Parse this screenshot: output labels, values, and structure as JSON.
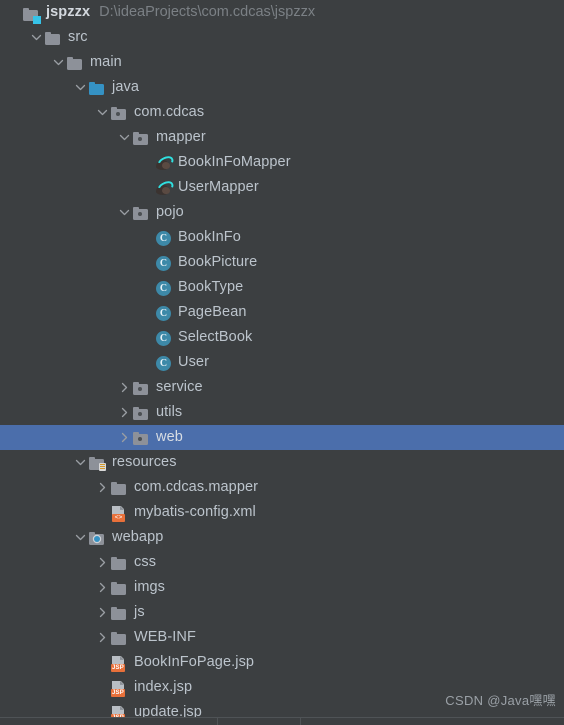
{
  "window": {
    "background_color": "#3c3f41",
    "selection_color": "#4b6eab",
    "text_color": "#bcc4cc",
    "path_text_color": "#7b8085"
  },
  "project": {
    "root_label": "jspzzx",
    "root_path": "D:\\ideaProjects\\com.cdcas\\jspzzx"
  },
  "watermark": "CSDN @Java嘿嘿",
  "tree": {
    "items": [
      {
        "label": "jspzzx",
        "path": "D:\\ideaProjects\\com.cdcas\\jspzzx",
        "depth": 0,
        "icon": "project-root-folder-icon",
        "arrow": "none",
        "selected": false
      },
      {
        "label": "src",
        "depth": 1,
        "icon": "folder-icon",
        "arrow": "expanded",
        "selected": false
      },
      {
        "label": "main",
        "depth": 2,
        "icon": "folder-icon",
        "arrow": "expanded",
        "selected": false
      },
      {
        "label": "java",
        "depth": 3,
        "icon": "source-root-folder-icon",
        "arrow": "expanded",
        "selected": false
      },
      {
        "label": "com.cdcas",
        "depth": 4,
        "icon": "package-folder-icon",
        "arrow": "expanded",
        "selected": false
      },
      {
        "label": "mapper",
        "depth": 5,
        "icon": "package-folder-icon",
        "arrow": "expanded",
        "selected": false
      },
      {
        "label": "BookInFoMapper",
        "depth": 6,
        "icon": "mybatis-mapper-icon",
        "arrow": "none",
        "selected": false
      },
      {
        "label": "UserMapper",
        "depth": 6,
        "icon": "mybatis-mapper-icon",
        "arrow": "none",
        "selected": false
      },
      {
        "label": "pojo",
        "depth": 5,
        "icon": "package-folder-icon",
        "arrow": "expanded",
        "selected": false
      },
      {
        "label": "BookInFo",
        "depth": 6,
        "icon": "java-class-icon",
        "arrow": "none",
        "selected": false
      },
      {
        "label": "BookPicture",
        "depth": 6,
        "icon": "java-class-icon",
        "arrow": "none",
        "selected": false
      },
      {
        "label": "BookType",
        "depth": 6,
        "icon": "java-class-icon",
        "arrow": "none",
        "selected": false
      },
      {
        "label": "PageBean",
        "depth": 6,
        "icon": "java-class-icon",
        "arrow": "none",
        "selected": false
      },
      {
        "label": "SelectBook",
        "depth": 6,
        "icon": "java-class-icon",
        "arrow": "none",
        "selected": false
      },
      {
        "label": "User",
        "depth": 6,
        "icon": "java-class-icon",
        "arrow": "none",
        "selected": false
      },
      {
        "label": "service",
        "depth": 5,
        "icon": "package-folder-icon",
        "arrow": "collapsed",
        "selected": false
      },
      {
        "label": "utils",
        "depth": 5,
        "icon": "package-folder-icon",
        "arrow": "collapsed",
        "selected": false
      },
      {
        "label": "web",
        "depth": 5,
        "icon": "package-folder-icon",
        "arrow": "collapsed",
        "selected": true
      },
      {
        "label": "resources",
        "depth": 3,
        "icon": "resources-root-icon",
        "arrow": "expanded",
        "selected": false
      },
      {
        "label": "com.cdcas.mapper",
        "depth": 4,
        "icon": "folder-icon",
        "arrow": "collapsed",
        "selected": false
      },
      {
        "label": "mybatis-config.xml",
        "depth": 4,
        "icon": "xml-file-icon",
        "arrow": "none",
        "selected": false
      },
      {
        "label": "webapp",
        "depth": 3,
        "icon": "web-root-folder-icon",
        "arrow": "expanded",
        "selected": false
      },
      {
        "label": "css",
        "depth": 4,
        "icon": "folder-icon",
        "arrow": "collapsed",
        "selected": false
      },
      {
        "label": "imgs",
        "depth": 4,
        "icon": "folder-icon",
        "arrow": "collapsed",
        "selected": false
      },
      {
        "label": "js",
        "depth": 4,
        "icon": "folder-icon",
        "arrow": "collapsed",
        "selected": false
      },
      {
        "label": "WEB-INF",
        "depth": 4,
        "icon": "folder-icon",
        "arrow": "collapsed",
        "selected": false
      },
      {
        "label": "BookInFoPage.jsp",
        "depth": 4,
        "icon": "jsp-file-icon",
        "arrow": "none",
        "selected": false
      },
      {
        "label": "index.jsp",
        "depth": 4,
        "icon": "jsp-file-icon",
        "arrow": "none",
        "selected": false
      },
      {
        "label": "update.jsp",
        "depth": 4,
        "icon": "jsp-file-icon",
        "arrow": "none",
        "selected": false
      }
    ]
  },
  "icon_glyphs": {
    "java_class_letter": "C",
    "xml_badge": "<>",
    "jsp_badge": "JSP"
  }
}
